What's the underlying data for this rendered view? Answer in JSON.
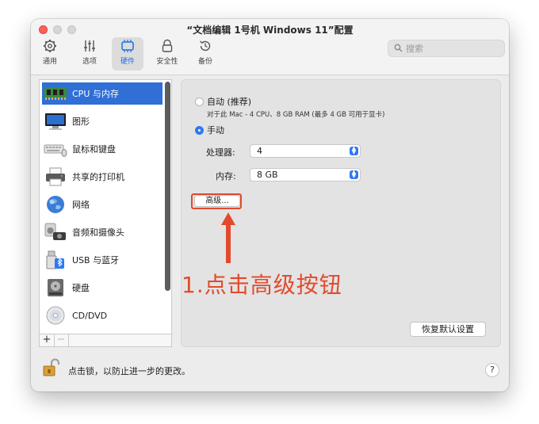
{
  "window": {
    "title": "“文档编辑 1号机 Windows 11”配置"
  },
  "toolbar": {
    "items": [
      {
        "label": "通用",
        "icon": "gear-icon"
      },
      {
        "label": "选项",
        "icon": "sliders-icon"
      },
      {
        "label": "硬件",
        "icon": "chip-icon",
        "active": true
      },
      {
        "label": "安全性",
        "icon": "lock-icon"
      },
      {
        "label": "备份",
        "icon": "history-icon"
      }
    ],
    "search_placeholder": "搜索"
  },
  "sidebar": {
    "items": [
      {
        "label": "CPU 与内存",
        "icon": "memory-icon",
        "selected": true
      },
      {
        "label": "图形",
        "icon": "monitor-icon"
      },
      {
        "label": "鼠标和键盘",
        "icon": "keyboard-icon"
      },
      {
        "label": "共享的打印机",
        "icon": "printer-icon"
      },
      {
        "label": "网络",
        "icon": "globe-icon"
      },
      {
        "label": "音频和摄像头",
        "icon": "speaker-camera-icon"
      },
      {
        "label": "USB 与蓝牙",
        "icon": "usb-icon"
      },
      {
        "label": "硬盘",
        "icon": "harddisk-icon"
      },
      {
        "label": "CD/DVD",
        "icon": "disc-icon"
      }
    ],
    "add_label": "+",
    "remove_label": "−"
  },
  "panel": {
    "auto_label": "自动 (推荐)",
    "auto_desc": "对于此 Mac - 4 CPU、8 GB RAM (最多 4 GB 可用于显卡)",
    "manual_label": "手动",
    "processor_label": "处理器:",
    "processor_value": "4",
    "memory_label": "内存:",
    "memory_value": "8 GB",
    "advanced_label": "高级...",
    "restore_label": "恢复默认设置"
  },
  "annotation": {
    "text": "1.点击高级按钮",
    "color": "#e24a2d"
  },
  "footer": {
    "lock_text": "点击锁，以防止进一步的更改。",
    "help_label": "?"
  },
  "colors": {
    "accent": "#2f78f2",
    "selection": "#2f6fd6",
    "annotation": "#e24a2d"
  }
}
